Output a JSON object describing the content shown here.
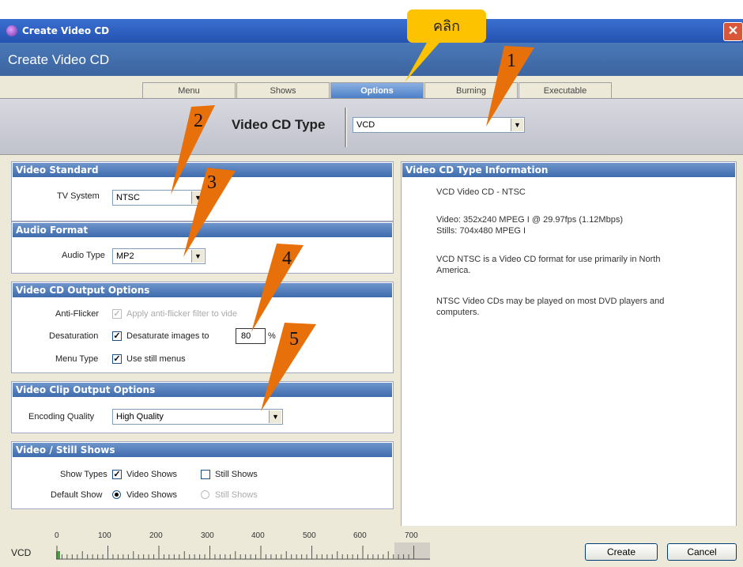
{
  "window": {
    "title": "Create Video CD",
    "header": "Create Video CD",
    "close_glyph": "✕"
  },
  "tabs": [
    {
      "label": "Menu",
      "active": false
    },
    {
      "label": "Shows",
      "active": false
    },
    {
      "label": "Options",
      "active": true
    },
    {
      "label": "Burning",
      "active": false
    },
    {
      "label": "Executable",
      "active": false
    }
  ],
  "video_cd_type": {
    "label": "Video CD Type",
    "value": "VCD"
  },
  "video_standard": {
    "heading": "Video Standard",
    "tv_system_label": "TV System",
    "tv_system_value": "NTSC"
  },
  "audio_format": {
    "heading": "Audio Format",
    "audio_type_label": "Audio Type",
    "audio_type_value": "MP2"
  },
  "output_options": {
    "heading": "Video CD Output Options",
    "anti_flicker_label": "Anti-Flicker",
    "anti_flicker_text": "Apply anti-flicker filter to vide",
    "desaturation_label": "Desaturation",
    "desaturate_text": "Desaturate images to",
    "desaturate_value": "80",
    "percent": "%",
    "menu_type_label": "Menu Type",
    "menu_type_text": "Use still menus"
  },
  "clip_options": {
    "heading": "Video Clip Output Options",
    "encoding_label": "Encoding Quality",
    "encoding_value": "High Quality"
  },
  "still_shows": {
    "heading": "Video / Still Shows",
    "show_types_label": "Show Types",
    "video_shows": "Video Shows",
    "still_shows": "Still Shows",
    "default_show_label": "Default Show"
  },
  "info_panel": {
    "heading": "Video CD Type Information",
    "line1": "VCD Video CD - NTSC",
    "line2": "Video: 352x240 MPEG I @ 29.97fps (1.12Mbps)",
    "line3": "Stills: 704x480 MPEG I",
    "line4": "VCD NTSC is a Video CD format for use primarily in North",
    "line5": "America.",
    "line6": "NTSC Video CDs may be played on most DVD players and",
    "line7": "computers."
  },
  "footer": {
    "disc_label": "VCD",
    "ticks": [
      "0",
      "100",
      "200",
      "300",
      "400",
      "500",
      "600",
      "700"
    ],
    "create_button": "Create",
    "cancel_button": "Cancel"
  },
  "annotations": {
    "callout": "คลิก",
    "n1": "1",
    "n2": "2",
    "n3": "3",
    "n4": "4",
    "n5": "5"
  },
  "colors": {
    "accent": "#3f6cad",
    "arrow": "#e8700a",
    "callout": "#fdc300"
  }
}
